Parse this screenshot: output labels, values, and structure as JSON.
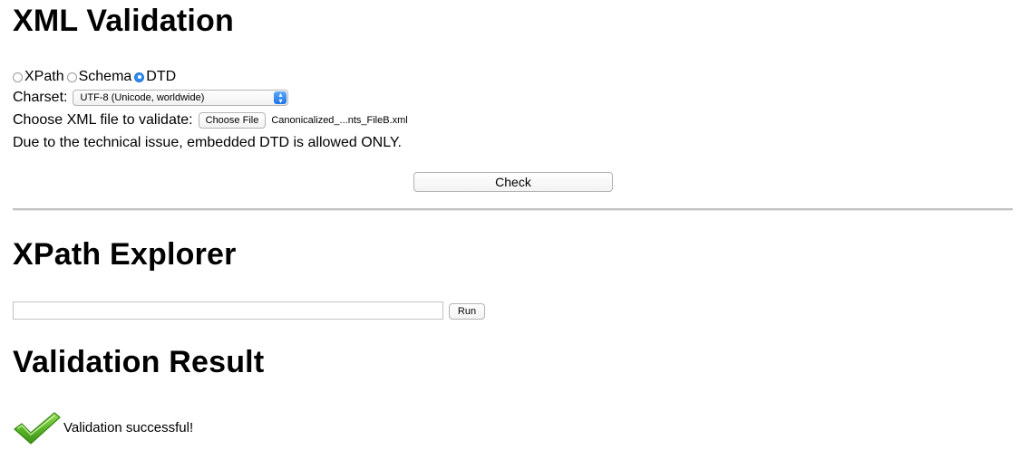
{
  "xml_validation": {
    "title": "XML Validation",
    "radio_options": [
      {
        "label": "XPath",
        "checked": false
      },
      {
        "label": "Schema",
        "checked": false
      },
      {
        "label": "DTD",
        "checked": true
      }
    ],
    "charset_label": "Charset:",
    "charset_value": "UTF-8 (Unicode, worldwide)",
    "file_label": "Choose XML file to validate:",
    "file_button": "Choose File",
    "file_name": "Canonicalized_...nts_FileB.xml",
    "notice": "Due to the technical issue, embedded DTD is allowed ONLY.",
    "check_button": "Check"
  },
  "xpath_explorer": {
    "title": "XPath Explorer",
    "input_value": "",
    "run_button": "Run"
  },
  "validation_result": {
    "title": "Validation Result",
    "icon": "checkmark-icon",
    "message": "Validation successful!"
  },
  "colors": {
    "radio_checked": "#2d8cf0",
    "check_icon": "#5cb82a"
  }
}
